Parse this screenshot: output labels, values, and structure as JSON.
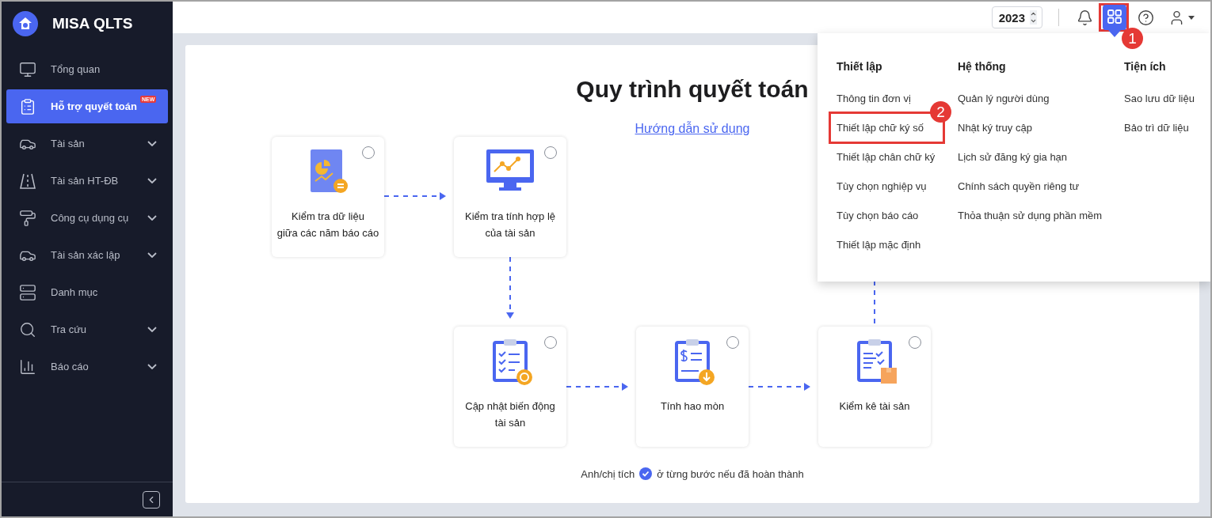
{
  "app": {
    "name": "MISA QLTS"
  },
  "sidebar": {
    "items": [
      {
        "label": "Tổng quan",
        "selected": false,
        "expandable": false
      },
      {
        "label": "Hỗ trợ quyết toán",
        "selected": true,
        "expandable": false,
        "badge": "NEW"
      },
      {
        "label": "Tài sản",
        "selected": false,
        "expandable": true
      },
      {
        "label": "Tài sản HT-ĐB",
        "selected": false,
        "expandable": true
      },
      {
        "label": "Công cụ dụng cụ",
        "selected": false,
        "expandable": true
      },
      {
        "label": "Tài sản xác lập",
        "selected": false,
        "expandable": true
      },
      {
        "label": "Danh mục",
        "selected": false,
        "expandable": false
      },
      {
        "label": "Tra cứu",
        "selected": false,
        "expandable": true
      },
      {
        "label": "Báo cáo",
        "selected": false,
        "expandable": true
      }
    ]
  },
  "header": {
    "year": "2023",
    "apps_menu": {
      "open": true,
      "callout": "1"
    }
  },
  "page": {
    "title": "Quy trình quyết toán",
    "guide_link": "Hướng dẫn sử dụng",
    "steps": [
      {
        "label": "Kiểm tra dữ liệu\ngiữa các năm báo cáo",
        "kind": "report",
        "checked": false
      },
      {
        "label": "Kiểm tra tính hợp lệ\ncủa tài sản",
        "kind": "monitor",
        "checked": false
      },
      {
        "label": "Cập nhật biến động\ntài sản",
        "kind": "clipboard-refresh",
        "checked": false
      },
      {
        "label": "Tính hao mòn",
        "kind": "clipboard-money",
        "checked": false
      },
      {
        "label": "Kiểm kê tài sản",
        "kind": "clipboard-box",
        "checked": false
      }
    ],
    "hint_before": "Anh/chị tích",
    "hint_after": "ở từng bước nếu đã hoàn thành"
  },
  "menu": {
    "columns": [
      {
        "heading": "Thiết lập",
        "items": [
          {
            "label": "Thông tin đơn vị"
          },
          {
            "label": "Thiết lập chữ ký số",
            "callout": "2"
          },
          {
            "label": "Thiết lập chân chữ ký"
          },
          {
            "label": "Tùy chọn nghiệp vụ"
          },
          {
            "label": "Tùy chọn báo cáo"
          },
          {
            "label": "Thiết lập mặc định"
          }
        ]
      },
      {
        "heading": "Hệ thống",
        "items": [
          {
            "label": "Quản lý người dùng"
          },
          {
            "label": "Nhật ký truy cập"
          },
          {
            "label": "Lịch sử đăng ký gia hạn"
          },
          {
            "label": "Chính sách quyền riêng tư"
          },
          {
            "label": "Thỏa thuận sử dụng phần mềm"
          }
        ]
      },
      {
        "heading": "Tiện ích",
        "items": [
          {
            "label": "Sao lưu dữ liệu"
          },
          {
            "label": "Bảo trì dữ liệu"
          }
        ]
      }
    ]
  }
}
